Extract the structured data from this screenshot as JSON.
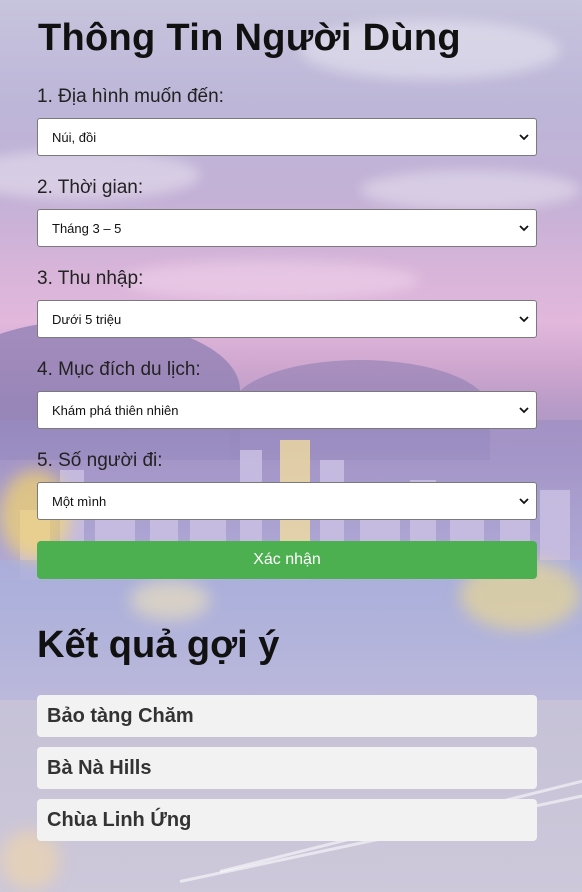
{
  "form": {
    "title": "Thông Tin Người Dùng",
    "fields": [
      {
        "label": "1. Địa hình muốn đến:",
        "value": "Núi, đồi"
      },
      {
        "label": "2. Thời gian:",
        "value": "Tháng 3 – 5"
      },
      {
        "label": "3. Thu nhập:",
        "value": "Dưới 5 triệu"
      },
      {
        "label": "4. Mục đích du lịch:",
        "value": "Khám phá thiên nhiên"
      },
      {
        "label": "5. Số người đi:",
        "value": "Một mình"
      }
    ],
    "submit_label": "Xác nhận"
  },
  "results": {
    "title": "Kết quả gợi ý",
    "items": [
      {
        "name": "Bảo tàng Chăm"
      },
      {
        "name": "Bà Nà Hills"
      },
      {
        "name": "Chùa Linh Ứng"
      }
    ]
  },
  "colors": {
    "submit_button": "#4caf50",
    "result_card": "#f2f2f2"
  },
  "icons": {
    "select_arrow": "chevron-down-icon"
  }
}
